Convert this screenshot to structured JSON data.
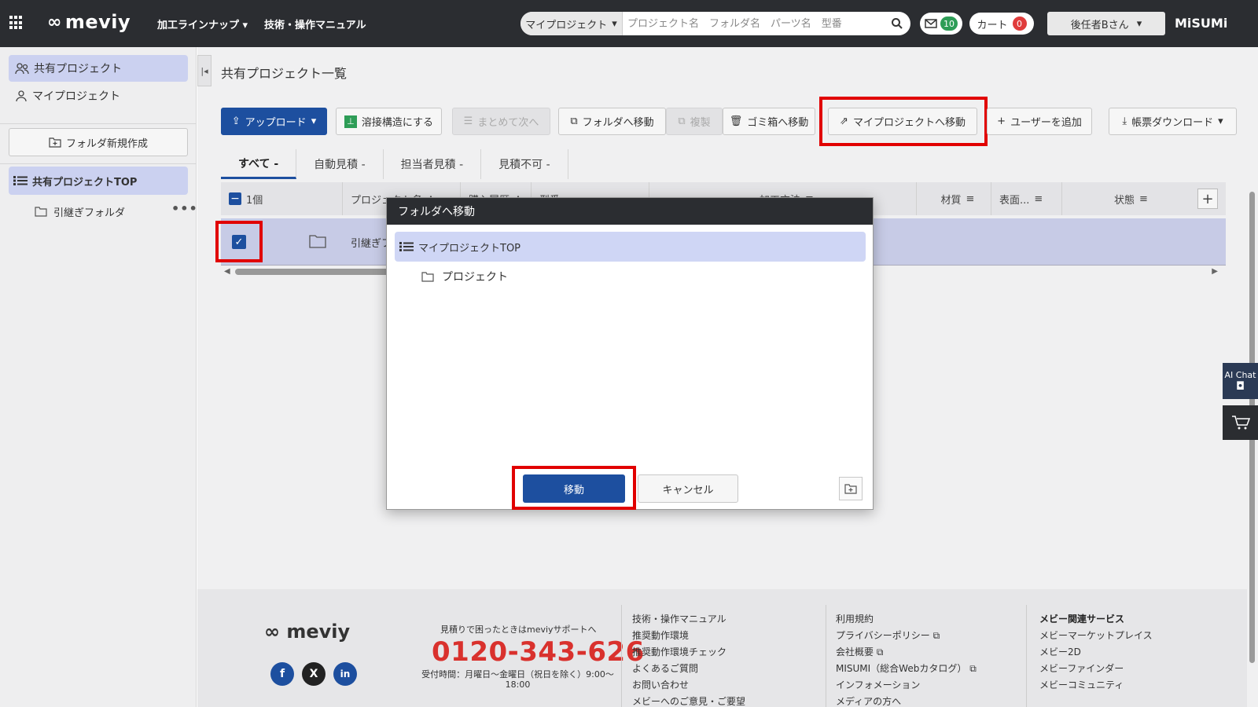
{
  "header": {
    "logo": "meviy",
    "nav": [
      "加工ラインナップ",
      "技術・操作マニュアル"
    ],
    "search_scope": "マイプロジェクト",
    "search_placeholder": "プロジェクト名　フォルダ名　パーツ名　型番",
    "mail_count": "10",
    "cart_label": "カート",
    "cart_count": "0",
    "user": "後任者Bさん",
    "brand": "MiSUMi"
  },
  "sidebar": {
    "shared_projects": "共有プロジェクト",
    "my_projects": "マイプロジェクト",
    "new_folder": "フォルダ新規作成",
    "tree_top": "共有プロジェクトTOP",
    "child_folder": "引継ぎフォルダ"
  },
  "main": {
    "title": "共有プロジェクト一覧",
    "toolbar": {
      "upload": "アップロード",
      "weld": "溶接構造にする",
      "batch_next": "まとめて次へ",
      "move_folder": "フォルダへ移動",
      "copy": "複製",
      "trash": "ゴミ箱へ移動",
      "move_my_project": "マイプロジェクトへ移動",
      "add_user": "ユーザーを追加",
      "download": "帳票ダウンロード"
    },
    "tabs": [
      "すべて -",
      "自動見積 -",
      "担当者見積 -",
      "見積不可 -"
    ],
    "table": {
      "count": "1個",
      "columns": [
        "プロジェクト名",
        "購入履歴",
        "型番",
        "加工方法",
        "材質",
        "表面...",
        "状態"
      ],
      "row_name": "引継ぎフ"
    }
  },
  "widgets": {
    "ai_chat": "AI Chat"
  },
  "modal": {
    "title": "フォルダへ移動",
    "top_item": "マイプロジェクトTOP",
    "child": "プロジェクト",
    "move": "移動",
    "cancel": "キャンセル"
  },
  "footer": {
    "logo": "meviy",
    "support_lead": "見積りで困ったときはmeviyサポートへ",
    "phone": "0120-343-626",
    "hours": "受付時間：月曜日〜金曜日（祝日を除く）9:00〜18:00",
    "col1": [
      "技術・操作マニュアル",
      "推奨動作環境",
      "推奨動作環境チェック",
      "よくあるご質問",
      "お問い合わせ",
      "メビーへのご意見・ご要望"
    ],
    "col2": [
      "利用規約",
      "プライバシーポリシー",
      "会社概要",
      "MISUMI（総合Webカタログ）",
      "インフォメーション",
      "メディアの方へ"
    ],
    "col3_head": "メビー関連サービス",
    "col3": [
      "メビーマーケットプレイス",
      "メビー2D",
      "メビーファインダー",
      "メビーコミュニティ"
    ]
  },
  "colors": {
    "header_bg": "#2b2d31",
    "primary": "#1d4f9f",
    "highlight": "#e10000",
    "phone": "#d9312d"
  }
}
